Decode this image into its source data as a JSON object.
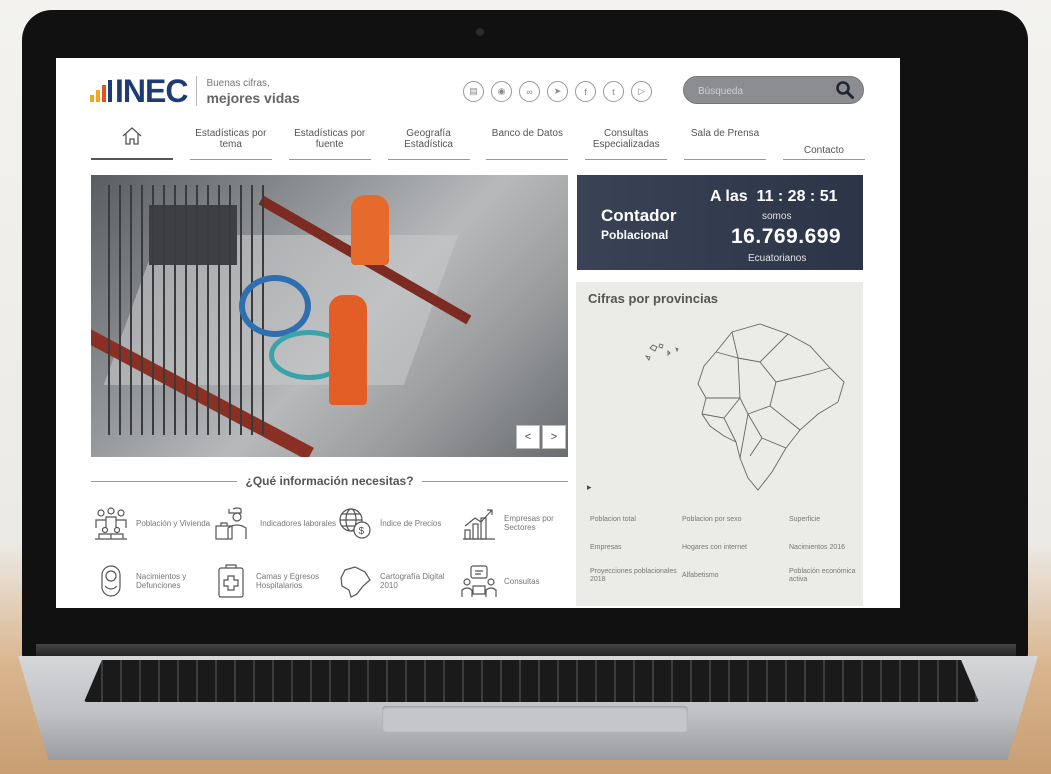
{
  "header": {
    "logo_text": "INEC",
    "tagline_line1": "Buenas cifras,",
    "tagline_line2": "mejores vidas",
    "social_icons": [
      "rss-icon",
      "podcast-icon",
      "flickr-icon",
      "telegram-icon",
      "facebook-icon",
      "twitter-icon",
      "youtube-icon"
    ],
    "search_placeholder": "Búsqueda"
  },
  "nav": {
    "items": [
      {
        "label": "",
        "icon": "home-icon"
      },
      {
        "label": "Estadísticas por tema"
      },
      {
        "label": "Estadísticas por fuente"
      },
      {
        "label": "Geografía Estadística"
      },
      {
        "label": "Banco de Datos"
      },
      {
        "label": "Consultas Especializadas"
      },
      {
        "label": "Sala de Prensa"
      },
      {
        "label": "Contacto"
      }
    ]
  },
  "carousel": {
    "prev": "<",
    "next": ">"
  },
  "counter": {
    "title": "Contador",
    "subtitle": "Poblacional",
    "time_prefix": "A las",
    "time": "11 : 28 : 51",
    "somos": "somos",
    "population": "16.769.699",
    "suffix": "Ecuatorianos",
    "accent": "#2f3a4d"
  },
  "provinces": {
    "title": "Cifras por provincias",
    "play": "▸",
    "links": [
      "Poblacion total",
      "Poblacion por sexo",
      "Superficie",
      "Empresas",
      "Hogares con internet",
      "Nacimientos 2016",
      "Proyecciones poblacionales 2018",
      "Alfabetismo",
      "Población económica activa"
    ]
  },
  "info": {
    "title": "¿Qué información necesitas?",
    "categories": [
      {
        "label": "Población y Vivienda",
        "icon": "population-icon"
      },
      {
        "label": "Indicadores laborales",
        "icon": "worker-icon"
      },
      {
        "label": "Índice de Precios",
        "icon": "price-globe-icon"
      },
      {
        "label": "Empresas por Sectores",
        "icon": "growth-chart-icon"
      },
      {
        "label": "Nacimientos y Defunciones",
        "icon": "baby-icon"
      },
      {
        "label": "Camas y Egresos Hospitalarios",
        "icon": "hospital-clipboard-icon"
      },
      {
        "label": "Cartografía Digital 2010",
        "icon": "map-outline-icon"
      },
      {
        "label": "Consultas",
        "icon": "consult-icon"
      }
    ]
  },
  "colors": {
    "brand_blue": "#1f3b73",
    "brand_orange": "#f7a51c",
    "brand_red": "#e7511e"
  }
}
